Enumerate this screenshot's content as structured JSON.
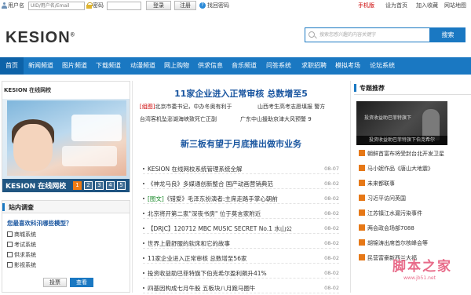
{
  "topbar": {
    "username_label": "用户名",
    "username_placeholder": "UID/用户名/Email",
    "password_label": "密码",
    "login_button": "登录",
    "register_button": "注册",
    "forgot_password": "找回密码",
    "mobile_version": "手机版",
    "set_home": "设为首页",
    "add_favorite": "加入收藏",
    "site_map": "网站地图"
  },
  "header": {
    "logo_text": "KESION",
    "search_placeholder": "搜索您感兴趣的内容关键字",
    "search_button": "搜索"
  },
  "nav": {
    "items": [
      "首页",
      "新闻频道",
      "图片频道",
      "下载频道",
      "动漫频道",
      "网上购物",
      "供求信息",
      "音乐频道",
      "问答系统",
      "求职招聘",
      "模拟考场",
      "论坛系统"
    ]
  },
  "slider": {
    "logo": "KESION 在线网校",
    "caption": "KESION 在线网校",
    "pages": [
      "1",
      "2",
      "3",
      "4",
      "5"
    ],
    "active_page": 1
  },
  "survey": {
    "title": "站内调查",
    "question": "您最喜欢科汛哪些模型？",
    "options": [
      "商城系统",
      "考试系统",
      "供求系统",
      "影视系统"
    ],
    "vote_button": "投票",
    "view_button": "查看"
  },
  "center": {
    "headline1": "11家企业进入正常审核  总数增至5",
    "sub_items": [
      {
        "tag": "[组图]",
        "text": "北京市委书记，中办冬奥有利于"
      },
      {
        "tag": "",
        "text": "山西考生高考志愿填报 警方"
      },
      {
        "tag": "",
        "text": "台湾客机坠澎湖海峡致死亡正副"
      },
      {
        "tag": "",
        "text": "广东中山援助京津大风预警 9"
      }
    ],
    "headline2": "新三板有望于月底推出做市业务",
    "news": [
      {
        "cat": "",
        "title": "KESION 在线网校系统管理系统全解",
        "date": "08-07"
      },
      {
        "cat": "",
        "title": "《神龙马良》多媒通创新整合  国产动画营销典范",
        "date": "08-02"
      },
      {
        "cat": "[图文]",
        "title": "《错爱》毛泽东扮演者:主席走路手掌心朝前",
        "date": "08-02"
      },
      {
        "cat": "",
        "title": "北京将开第二家\"深夜书房\" 位于莫言家附近",
        "date": "08-02"
      },
      {
        "cat": "",
        "title": "【DRJC】120712 MBC MUSIC SECRET No.1 水山公",
        "date": "08-02"
      },
      {
        "cat": "",
        "title": "世界上最舒服的软床和它的故事",
        "date": "08-02"
      },
      {
        "cat": "",
        "title": "11家企业进入正常审核  总数增至56家",
        "date": "08-02"
      },
      {
        "cat": "",
        "title": "投资收益助巴菲特旗下伯克希尔盈利飙升41%",
        "date": "08-02"
      },
      {
        "cat": "",
        "title": "四基因构成七月牛股  五板块八月跑马圈牛",
        "date": "08-02"
      }
    ]
  },
  "right": {
    "title": "专题推荐",
    "thumb_text": "投资收益助巴菲特旗下",
    "thumb_caption": "投资收益助巴菲特旗下伯克希尔",
    "items": [
      "朝鲜首富布将受封台北开发卫星",
      "马小妮作品《唐山大地震》",
      "未来都联事",
      "习近平访问英国",
      "江苏镇江水漏污染事件",
      "两会政会场部7088",
      "胡锦涛出席首尔核峰会等",
      "民营富豪新西兰大福"
    ]
  },
  "watermark": {
    "main": "脚本之家",
    "sub": "www.jb51.net"
  },
  "colors": {
    "brand_blue": "#1a78c2",
    "headline_blue": "#1a56a0",
    "accent_orange": "#f07b13",
    "tag_red": "#cc0000"
  }
}
